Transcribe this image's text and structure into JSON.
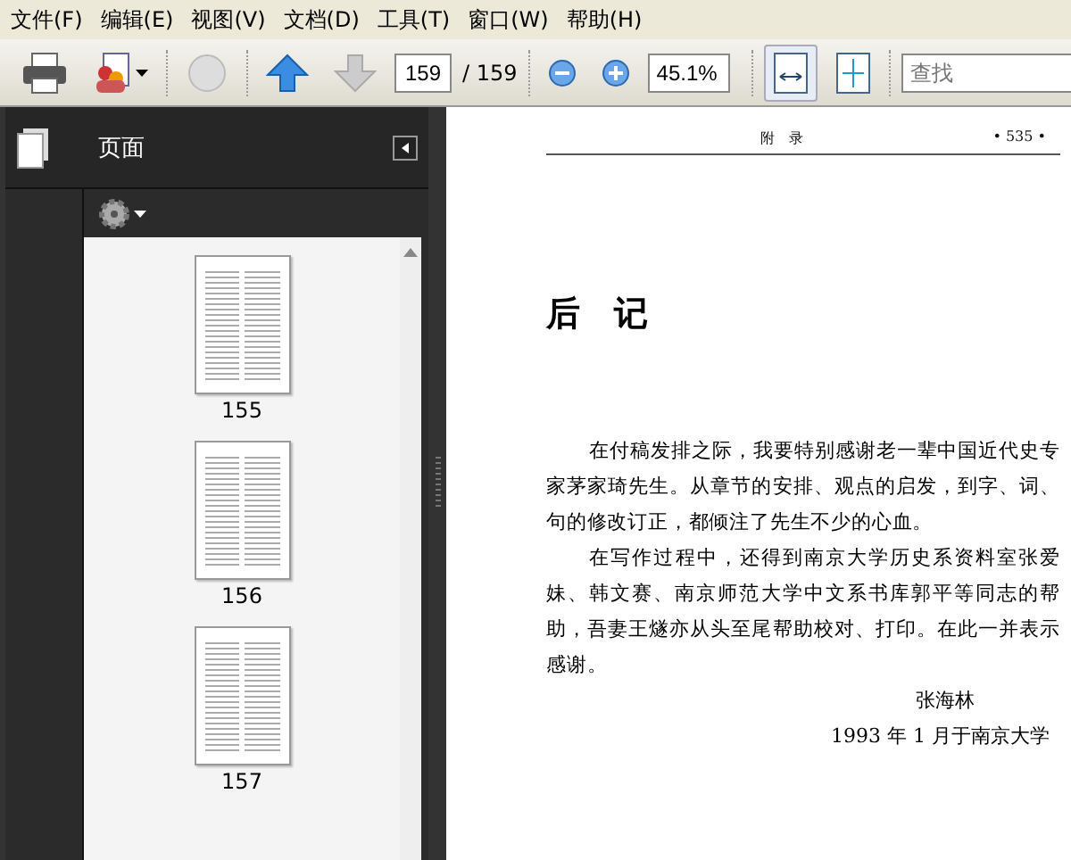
{
  "menu": [
    "文件(F)",
    "编辑(E)",
    "视图(V)",
    "文档(D)",
    "工具(T)",
    "窗口(W)",
    "帮助(H)"
  ],
  "toolbar": {
    "page_input": "159",
    "page_total": "/ 159",
    "zoom": "45.1%",
    "search": {
      "placeholder": "查找"
    },
    "fit_width_selected": true,
    "next_disabled": true
  },
  "pane": {
    "title": "页面",
    "thumbnails": [
      {
        "label": "155",
        "selected": false
      },
      {
        "label": "156",
        "selected": false
      },
      {
        "label": "157",
        "selected": false
      }
    ]
  },
  "page": {
    "header_left": "附　录",
    "header_right": "• 535 •",
    "title": "后　记",
    "paragraphs": [
      "在付稿发排之际，我要特别感谢老一辈中国近代史专家茅家琦先生。从章节的安排、观点的启发，到字、词、句的修改订正，都倾注了先生不少的心血。",
      "在写作过程中，还得到南京大学历史系资料室张爱妹、韩文赛、南京师范大学中文系书库郭平等同志的帮助，吾妻王燧亦从头至尾帮助校对、打印。在此一并表示感谢。"
    ],
    "signature": "张海林",
    "date": "1993 年 1 月于南京大学"
  }
}
